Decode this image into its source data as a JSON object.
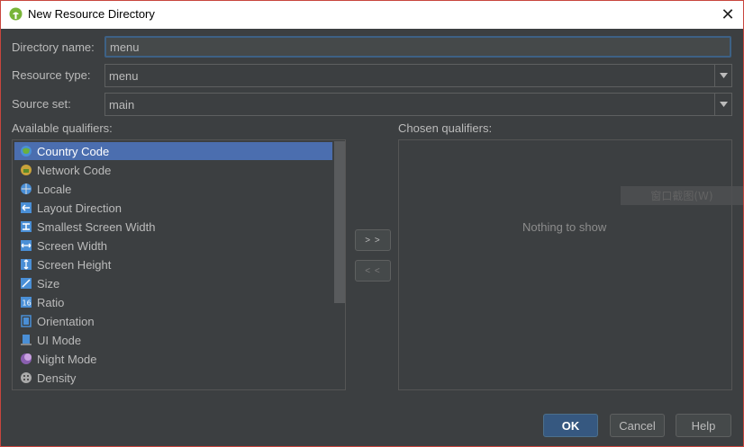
{
  "window": {
    "title": "New Resource Directory",
    "close_glyph": "✕"
  },
  "form": {
    "directory_name_label": "Directory name:",
    "directory_name_value": "menu",
    "resource_type_label": "Resource type:",
    "resource_type_value": "menu",
    "source_set_label": "Source set:",
    "source_set_value": "main"
  },
  "available": {
    "label": "Available qualifiers:",
    "items": [
      {
        "label": "Country Code",
        "icon": "country-code-icon"
      },
      {
        "label": "Network Code",
        "icon": "network-code-icon"
      },
      {
        "label": "Locale",
        "icon": "globe-icon"
      },
      {
        "label": "Layout Direction",
        "icon": "layout-direction-icon"
      },
      {
        "label": "Smallest Screen Width",
        "icon": "smallest-width-icon"
      },
      {
        "label": "Screen Width",
        "icon": "screen-width-icon"
      },
      {
        "label": "Screen Height",
        "icon": "screen-height-icon"
      },
      {
        "label": "Size",
        "icon": "size-icon"
      },
      {
        "label": "Ratio",
        "icon": "ratio-icon"
      },
      {
        "label": "Orientation",
        "icon": "orientation-icon"
      },
      {
        "label": "UI Mode",
        "icon": "ui-mode-icon"
      },
      {
        "label": "Night Mode",
        "icon": "night-mode-icon"
      },
      {
        "label": "Density",
        "icon": "density-icon"
      }
    ],
    "selected_index": 0
  },
  "chosen": {
    "label": "Chosen qualifiers:",
    "empty_text": "Nothing to show"
  },
  "transfer": {
    "add_label": "> >",
    "remove_label": "< <"
  },
  "overlay": {
    "text": "窗口截图(W)"
  },
  "buttons": {
    "ok": "OK",
    "cancel": "Cancel",
    "help": "Help"
  },
  "colors": {
    "accent": "#4b6eaf",
    "border_red": "#c8463e",
    "android_green": "#a4c639"
  }
}
